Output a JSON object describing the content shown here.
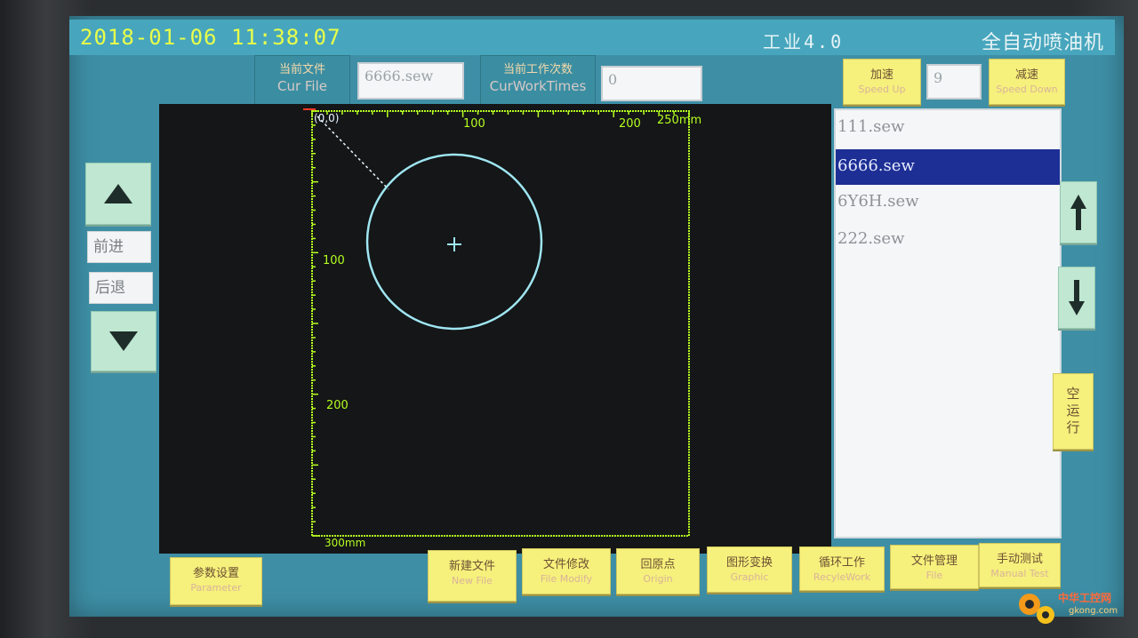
{
  "titlebar": {
    "datetime": "2018-01-06 11:38:07",
    "brand": "工业4.0",
    "machine_name": "全自动喷油机"
  },
  "file_info": {
    "cur_file_cn": "当前文件",
    "cur_file_en": "Cur File",
    "cur_file_value": "6666.sew",
    "work_times_cn": "当前工作次数",
    "work_times_en": "CurWorkTimes",
    "work_times_value": "0"
  },
  "speed": {
    "up_cn": "加速",
    "up_en": "Speed Up",
    "value": "9",
    "down_cn": "减速",
    "down_en": "Speed Down"
  },
  "file_list": {
    "items": [
      "111.sew",
      "6666.sew",
      "6Y6H.sew",
      "222.sew"
    ],
    "selected_index": 1
  },
  "left_controls": {
    "forward_label": "前进",
    "back_label": "后退"
  },
  "right_controls": {
    "dry_run_label": "空运行"
  },
  "canvas": {
    "origin_label": "(0,0)",
    "x_tick_100": "100",
    "x_tick_200": "200",
    "x_max_label": "250mm",
    "y_tick_100": "100",
    "y_tick_200": "200",
    "y_max_label": "300mm",
    "axis_color": "#b5ff1f",
    "shape_color": "#9fe6f2"
  },
  "bottom_buttons": [
    {
      "cn": "参数设置",
      "en": "Parameter"
    },
    {
      "cn": "新建文件",
      "en": "New File"
    },
    {
      "cn": "文件修改",
      "en": "File Modify"
    },
    {
      "cn": "回原点",
      "en": "Origin"
    },
    {
      "cn": "图形变换",
      "en": "Graphic"
    },
    {
      "cn": "循环工作",
      "en": "RecyleWork"
    },
    {
      "cn": "文件管理",
      "en": "File"
    },
    {
      "cn": "手动测试",
      "en": "Manual Test"
    }
  ],
  "watermark": {
    "cn": "中华工控网",
    "url": "gkong.com"
  }
}
